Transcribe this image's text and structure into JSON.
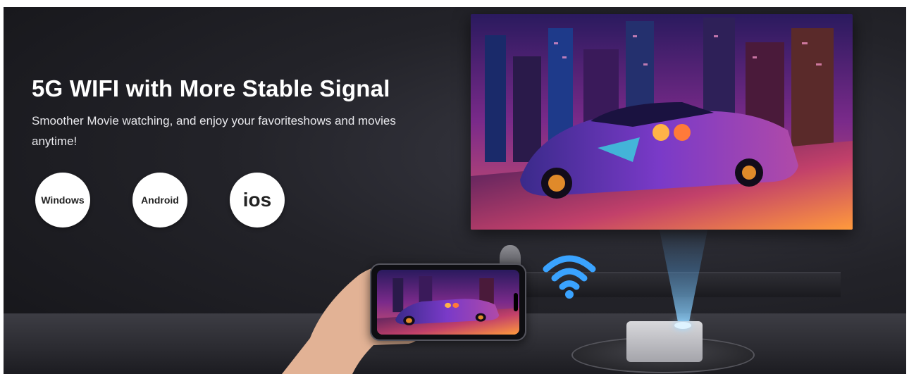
{
  "headline": "5G WIFI with More Stable Signal",
  "subtitle": "Smoother Movie watching, and enjoy your favoriteshows and movies anytime!",
  "platforms": [
    {
      "label": "Windows"
    },
    {
      "label": "Android"
    },
    {
      "label": "ios"
    }
  ],
  "colors": {
    "background": "#1c1c22",
    "headline": "#ffffff",
    "badge": "#ffffff",
    "wifi": "#3aa3ff",
    "beam": "#8fd0ff"
  },
  "icons": [
    "wifi-icon",
    "projector-icon",
    "smartphone-icon"
  ]
}
